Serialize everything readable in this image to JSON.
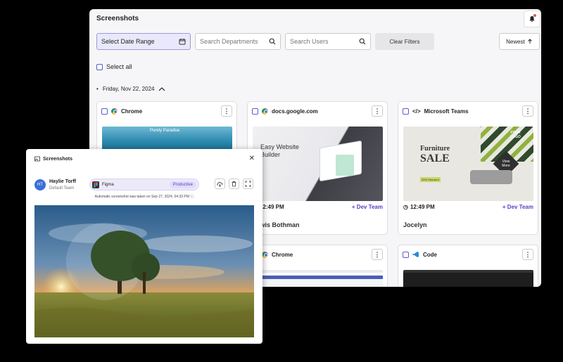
{
  "main": {
    "title": "Screenshots",
    "filters": {
      "date_label": "Select Date Range",
      "dept_placeholder": "Search Departments",
      "users_placeholder": "Search Users",
      "clear_label": "Clear Filters",
      "sort_label": "Newest"
    },
    "select_all_label": "Select all",
    "date_group": "Friday, Nov 22, 2024",
    "cards": [
      {
        "app": "Chrome",
        "thumb_text": "Purely Paradise"
      },
      {
        "app": "docs.google.com",
        "time": "12:49 PM",
        "team": "+ Dev Team",
        "user": "Lewis Bothman",
        "thumb_text": "Easy Website Builder"
      },
      {
        "app": "Microsoft Teams",
        "time": "12:49 PM",
        "team": "+ Dev Team",
        "user": "Jocelyn",
        "thumb_text": {
          "line1": "Furniture",
          "line2": "SALE",
          "logo": "YOUR LOGO",
          "cta": "View More",
          "badge": "20% Discount"
        }
      },
      {
        "app": "Chrome"
      },
      {
        "app": "Code"
      }
    ]
  },
  "popup": {
    "title": "Screenshots",
    "user_initials": "HT",
    "user_name": "Haylie Torff",
    "user_team": "Default Team",
    "app_name": "Figma",
    "status": "Productive",
    "caption": "Automatic screenshot was taken on Sep 27, 2024, 04:33 PM"
  },
  "colors": {
    "accent": "#5b3fc4",
    "filter_active_bg": "#e9e9fb"
  }
}
